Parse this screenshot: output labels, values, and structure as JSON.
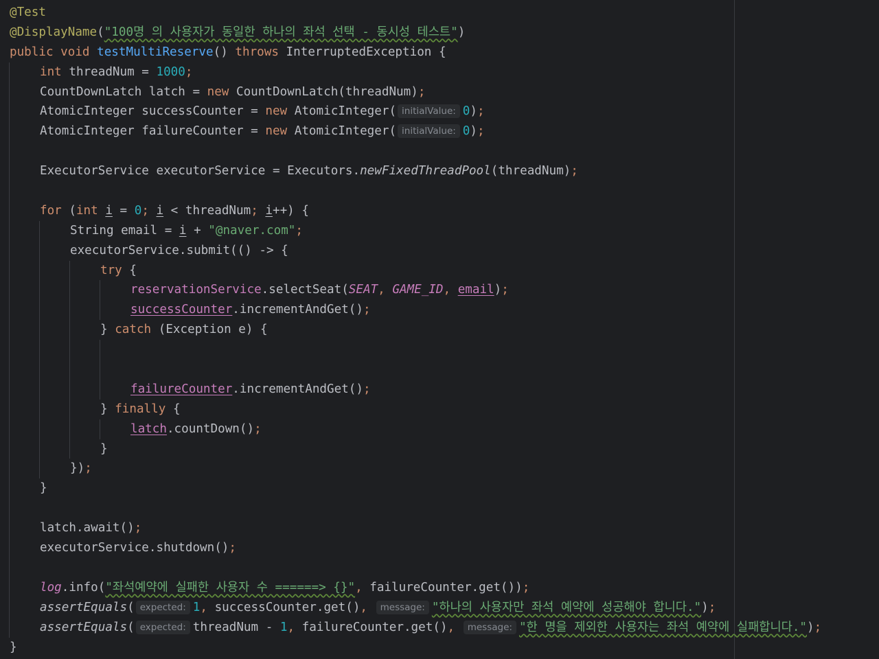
{
  "editor": {
    "lines": [
      {
        "indent": 0,
        "tokens": [
          {
            "t": "@Test",
            "c": "ann"
          }
        ]
      },
      {
        "indent": 0,
        "tokens": [
          {
            "t": "@DisplayName",
            "c": "ann"
          },
          {
            "t": "(",
            "c": "plain"
          },
          {
            "t": "\"100명 의 사용자가 동일한 하나의 좌석 선택 - 동시성 테스트\"",
            "c": "str"
          },
          {
            "t": ")",
            "c": "plain"
          }
        ]
      },
      {
        "indent": 0,
        "tokens": [
          {
            "t": "public ",
            "c": "kw"
          },
          {
            "t": "void ",
            "c": "kw"
          },
          {
            "t": "testMultiReserve",
            "c": "fn-decl"
          },
          {
            "t": "() ",
            "c": "plain"
          },
          {
            "t": "throws ",
            "c": "kw"
          },
          {
            "t": "InterruptedException {",
            "c": "plain"
          }
        ]
      },
      {
        "indent": 1,
        "tokens": [
          {
            "t": "int ",
            "c": "kw"
          },
          {
            "t": "threadNum = ",
            "c": "plain"
          },
          {
            "t": "1000",
            "c": "num"
          },
          {
            "t": ";",
            "c": "kw"
          }
        ]
      },
      {
        "indent": 1,
        "tokens": [
          {
            "t": "CountDownLatch latch = ",
            "c": "plain"
          },
          {
            "t": "new ",
            "c": "kw"
          },
          {
            "t": "CountDownLatch(threadNum)",
            "c": "plain"
          },
          {
            "t": ";",
            "c": "kw"
          }
        ]
      },
      {
        "indent": 1,
        "tokens": [
          {
            "t": "AtomicInteger successCounter = ",
            "c": "plain"
          },
          {
            "t": "new ",
            "c": "kw"
          },
          {
            "t": "AtomicInteger(",
            "c": "plain"
          },
          {
            "t": "initialValue:",
            "c": "hint"
          },
          {
            "t": "0",
            "c": "num"
          },
          {
            "t": ")",
            "c": "plain"
          },
          {
            "t": ";",
            "c": "kw"
          }
        ]
      },
      {
        "indent": 1,
        "tokens": [
          {
            "t": "AtomicInteger failureCounter = ",
            "c": "plain"
          },
          {
            "t": "new ",
            "c": "kw"
          },
          {
            "t": "AtomicInteger(",
            "c": "plain"
          },
          {
            "t": "initialValue:",
            "c": "hint"
          },
          {
            "t": "0",
            "c": "num"
          },
          {
            "t": ")",
            "c": "plain"
          },
          {
            "t": ";",
            "c": "kw"
          }
        ]
      },
      {
        "indent": 1,
        "tokens": []
      },
      {
        "indent": 1,
        "tokens": [
          {
            "t": "ExecutorService executorService = Executors.",
            "c": "plain"
          },
          {
            "t": "newFixedThreadPool",
            "c": "italic"
          },
          {
            "t": "(threadNum)",
            "c": "plain"
          },
          {
            "t": ";",
            "c": "kw"
          }
        ]
      },
      {
        "indent": 1,
        "tokens": []
      },
      {
        "indent": 1,
        "tokens": [
          {
            "t": "for ",
            "c": "kw"
          },
          {
            "t": "(",
            "c": "plain"
          },
          {
            "t": "int ",
            "c": "kw"
          },
          {
            "t": "i",
            "c": "plain-under"
          },
          {
            "t": " = ",
            "c": "plain"
          },
          {
            "t": "0",
            "c": "num"
          },
          {
            "t": "; ",
            "c": "kw"
          },
          {
            "t": "i",
            "c": "plain-under"
          },
          {
            "t": " < threadNum",
            "c": "plain"
          },
          {
            "t": "; ",
            "c": "kw"
          },
          {
            "t": "i",
            "c": "plain-under"
          },
          {
            "t": "++) {",
            "c": "plain"
          }
        ]
      },
      {
        "indent": 2,
        "tokens": [
          {
            "t": "String email = ",
            "c": "plain"
          },
          {
            "t": "i",
            "c": "plain-under"
          },
          {
            "t": " + ",
            "c": "plain"
          },
          {
            "t": "\"@naver.com\"",
            "c": "str"
          },
          {
            "t": ";",
            "c": "kw"
          }
        ]
      },
      {
        "indent": 2,
        "tokens": [
          {
            "t": "executorService.submit(() -> {",
            "c": "plain"
          }
        ]
      },
      {
        "indent": 3,
        "tokens": [
          {
            "t": "try ",
            "c": "kw"
          },
          {
            "t": "{",
            "c": "plain"
          }
        ]
      },
      {
        "indent": 4,
        "tokens": [
          {
            "t": "reservationService",
            "c": "field"
          },
          {
            "t": ".selectSeat(",
            "c": "plain"
          },
          {
            "t": "SEAT",
            "c": "static"
          },
          {
            "t": ", ",
            "c": "kw"
          },
          {
            "t": "GAME_ID",
            "c": "static"
          },
          {
            "t": ", ",
            "c": "kw"
          },
          {
            "t": "email",
            "c": "field-under"
          },
          {
            "t": ")",
            "c": "plain"
          },
          {
            "t": ";",
            "c": "kw"
          }
        ]
      },
      {
        "indent": 4,
        "tokens": [
          {
            "t": "successCounter",
            "c": "field-under"
          },
          {
            "t": ".incrementAndGet()",
            "c": "plain"
          },
          {
            "t": ";",
            "c": "kw"
          }
        ]
      },
      {
        "indent": 3,
        "tokens": [
          {
            "t": "} ",
            "c": "plain"
          },
          {
            "t": "catch ",
            "c": "kw"
          },
          {
            "t": "(Exception e) {",
            "c": "plain"
          }
        ]
      },
      {
        "indent": 4,
        "tokens": []
      },
      {
        "indent": 4,
        "tokens": []
      },
      {
        "indent": 4,
        "tokens": [
          {
            "t": "failureCounter",
            "c": "field-under"
          },
          {
            "t": ".incrementAndGet()",
            "c": "plain"
          },
          {
            "t": ";",
            "c": "kw"
          }
        ]
      },
      {
        "indent": 3,
        "tokens": [
          {
            "t": "} ",
            "c": "plain"
          },
          {
            "t": "finally ",
            "c": "kw"
          },
          {
            "t": "{",
            "c": "plain"
          }
        ]
      },
      {
        "indent": 4,
        "tokens": [
          {
            "t": "latch",
            "c": "field-under"
          },
          {
            "t": ".countDown()",
            "c": "plain"
          },
          {
            "t": ";",
            "c": "kw"
          }
        ]
      },
      {
        "indent": 3,
        "tokens": [
          {
            "t": "}",
            "c": "plain"
          }
        ]
      },
      {
        "indent": 2,
        "tokens": [
          {
            "t": "})",
            "c": "plain"
          },
          {
            "t": ";",
            "c": "kw"
          }
        ]
      },
      {
        "indent": 1,
        "tokens": [
          {
            "t": "}",
            "c": "plain"
          }
        ]
      },
      {
        "indent": 1,
        "tokens": []
      },
      {
        "indent": 1,
        "tokens": [
          {
            "t": "latch.await()",
            "c": "plain"
          },
          {
            "t": ";",
            "c": "kw"
          }
        ]
      },
      {
        "indent": 1,
        "tokens": [
          {
            "t": "executorService.shutdown()",
            "c": "plain"
          },
          {
            "t": ";",
            "c": "kw"
          }
        ]
      },
      {
        "indent": 1,
        "tokens": []
      },
      {
        "indent": 1,
        "tokens": [
          {
            "t": "log",
            "c": "static"
          },
          {
            "t": ".info(",
            "c": "plain"
          },
          {
            "t": "\"좌석예약에 실패한 사용자 수 ======> {}\"",
            "c": "str"
          },
          {
            "t": ", ",
            "c": "kw"
          },
          {
            "t": "failureCounter.get())",
            "c": "plain"
          },
          {
            "t": ";",
            "c": "kw"
          }
        ]
      },
      {
        "indent": 1,
        "tokens": [
          {
            "t": "assertEquals",
            "c": "italic"
          },
          {
            "t": "(",
            "c": "plain"
          },
          {
            "t": "expected:",
            "c": "hint"
          },
          {
            "t": "1",
            "c": "num"
          },
          {
            "t": ", ",
            "c": "kw"
          },
          {
            "t": "successCounter.get()",
            "c": "plain"
          },
          {
            "t": ", ",
            "c": "kw"
          },
          {
            "t": "message:",
            "c": "hint"
          },
          {
            "t": "\"하나의 사용자만 좌석 예약에 성공해야 합니다.\"",
            "c": "str"
          },
          {
            "t": ")",
            "c": "plain"
          },
          {
            "t": ";",
            "c": "kw"
          }
        ]
      },
      {
        "indent": 1,
        "tokens": [
          {
            "t": "assertEquals",
            "c": "italic"
          },
          {
            "t": "(",
            "c": "plain"
          },
          {
            "t": "expected:",
            "c": "hint"
          },
          {
            "t": "threadNum - ",
            "c": "plain"
          },
          {
            "t": "1",
            "c": "num"
          },
          {
            "t": ", ",
            "c": "kw"
          },
          {
            "t": "failureCounter.get()",
            "c": "plain"
          },
          {
            "t": ", ",
            "c": "kw"
          },
          {
            "t": "message:",
            "c": "hint"
          },
          {
            "t": "\"한 명을 제외한 사용자는 좌석 예약에 실패합니다.\"",
            "c": "str"
          },
          {
            "t": ")",
            "c": "plain"
          },
          {
            "t": ";",
            "c": "kw"
          }
        ]
      },
      {
        "indent": 0,
        "tokens": [
          {
            "t": "}",
            "c": "plain"
          }
        ]
      }
    ]
  }
}
